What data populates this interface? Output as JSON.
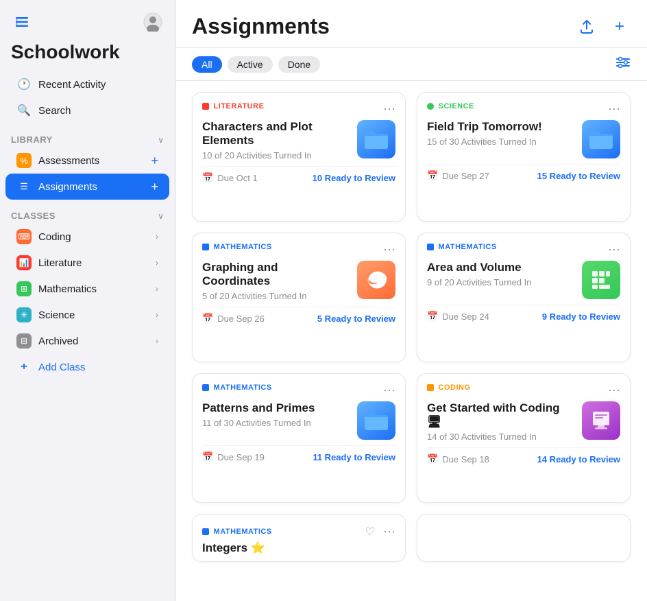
{
  "sidebar": {
    "title": "Schoolwork",
    "top_icons": {
      "sidebar_icon": "⊞",
      "profile_icon": "👤"
    },
    "nav_items": [
      {
        "id": "recent-activity",
        "label": "Recent Activity",
        "icon": "🕐"
      },
      {
        "id": "search",
        "label": "Search",
        "icon": "🔍"
      }
    ],
    "library": {
      "header": "Library",
      "items": [
        {
          "id": "assessments",
          "label": "Assessments",
          "icon": "%"
        },
        {
          "id": "assignments",
          "label": "Assignments",
          "icon": "☰",
          "active": true
        }
      ]
    },
    "classes": {
      "header": "Classes",
      "items": [
        {
          "id": "coding",
          "label": "Coding",
          "color": "#ff6b35"
        },
        {
          "id": "literature",
          "label": "Literature",
          "color": "#ff3b30"
        },
        {
          "id": "mathematics",
          "label": "Mathematics",
          "color": "#34c759"
        },
        {
          "id": "science",
          "label": "Science",
          "color": "#30b0c7"
        },
        {
          "id": "archived",
          "label": "Archived",
          "color": "#8e8e93"
        }
      ]
    },
    "add_class_label": "Add Class"
  },
  "main": {
    "title": "Assignments",
    "header_actions": {
      "upload_icon": "↑",
      "add_icon": "+"
    },
    "filter": {
      "tags": [
        "All",
        "Active",
        "Done"
      ],
      "active_tag": "All"
    },
    "filter_icon": "⊞",
    "assignments": [
      {
        "id": "characters-plot",
        "class_label": "Literature",
        "class_color": "#ff3b30",
        "title": "Characters and Plot Elements",
        "subtitle": "10 of 20 Activities Turned In",
        "due": "Due Oct 1",
        "ready": "10 Ready to Review",
        "icon_type": "folder-blue"
      },
      {
        "id": "field-trip",
        "class_label": "Science",
        "class_color": "#34c759",
        "title": "Field Trip Tomorrow!",
        "subtitle": "15 of 30 Activities Turned In",
        "due": "Due Sep 27",
        "ready": "15 Ready to Review",
        "icon_type": "folder-blue"
      },
      {
        "id": "graphing-coordinates",
        "class_label": "Mathematics",
        "class_color": "#1a6ff4",
        "title": "Graphing and Coordinates",
        "subtitle": "5 of 20 Activities Turned In",
        "due": "Due Sep 26",
        "ready": "5 Ready to Review",
        "icon_type": "swift"
      },
      {
        "id": "area-volume",
        "class_label": "Mathematics",
        "class_color": "#1a6ff4",
        "title": "Area and Volume",
        "subtitle": "9 of 20 Activities Turned In",
        "due": "Due Sep 24",
        "ready": "9 Ready to Review",
        "icon_type": "numbers"
      },
      {
        "id": "patterns-primes",
        "class_label": "Mathematics",
        "class_color": "#1a6ff4",
        "title": "Patterns and Primes",
        "subtitle": "11 of 30 Activities Turned In",
        "due": "Due Sep 19",
        "ready": "11 Ready to Review",
        "icon_type": "folder-blue"
      },
      {
        "id": "get-started-coding",
        "class_label": "Coding",
        "class_color": "#ff9500",
        "title": "Get Started with Coding 🖥",
        "subtitle": "14 of 30 Activities Turned In",
        "due": "Due Sep 18",
        "ready": "14 Ready to Review",
        "icon_type": "keynote"
      }
    ],
    "partial_assignment": {
      "class_label": "Mathematics",
      "class_color": "#1a6ff4",
      "title": "Integers ⭐",
      "icon_type": "folder-blue"
    }
  }
}
